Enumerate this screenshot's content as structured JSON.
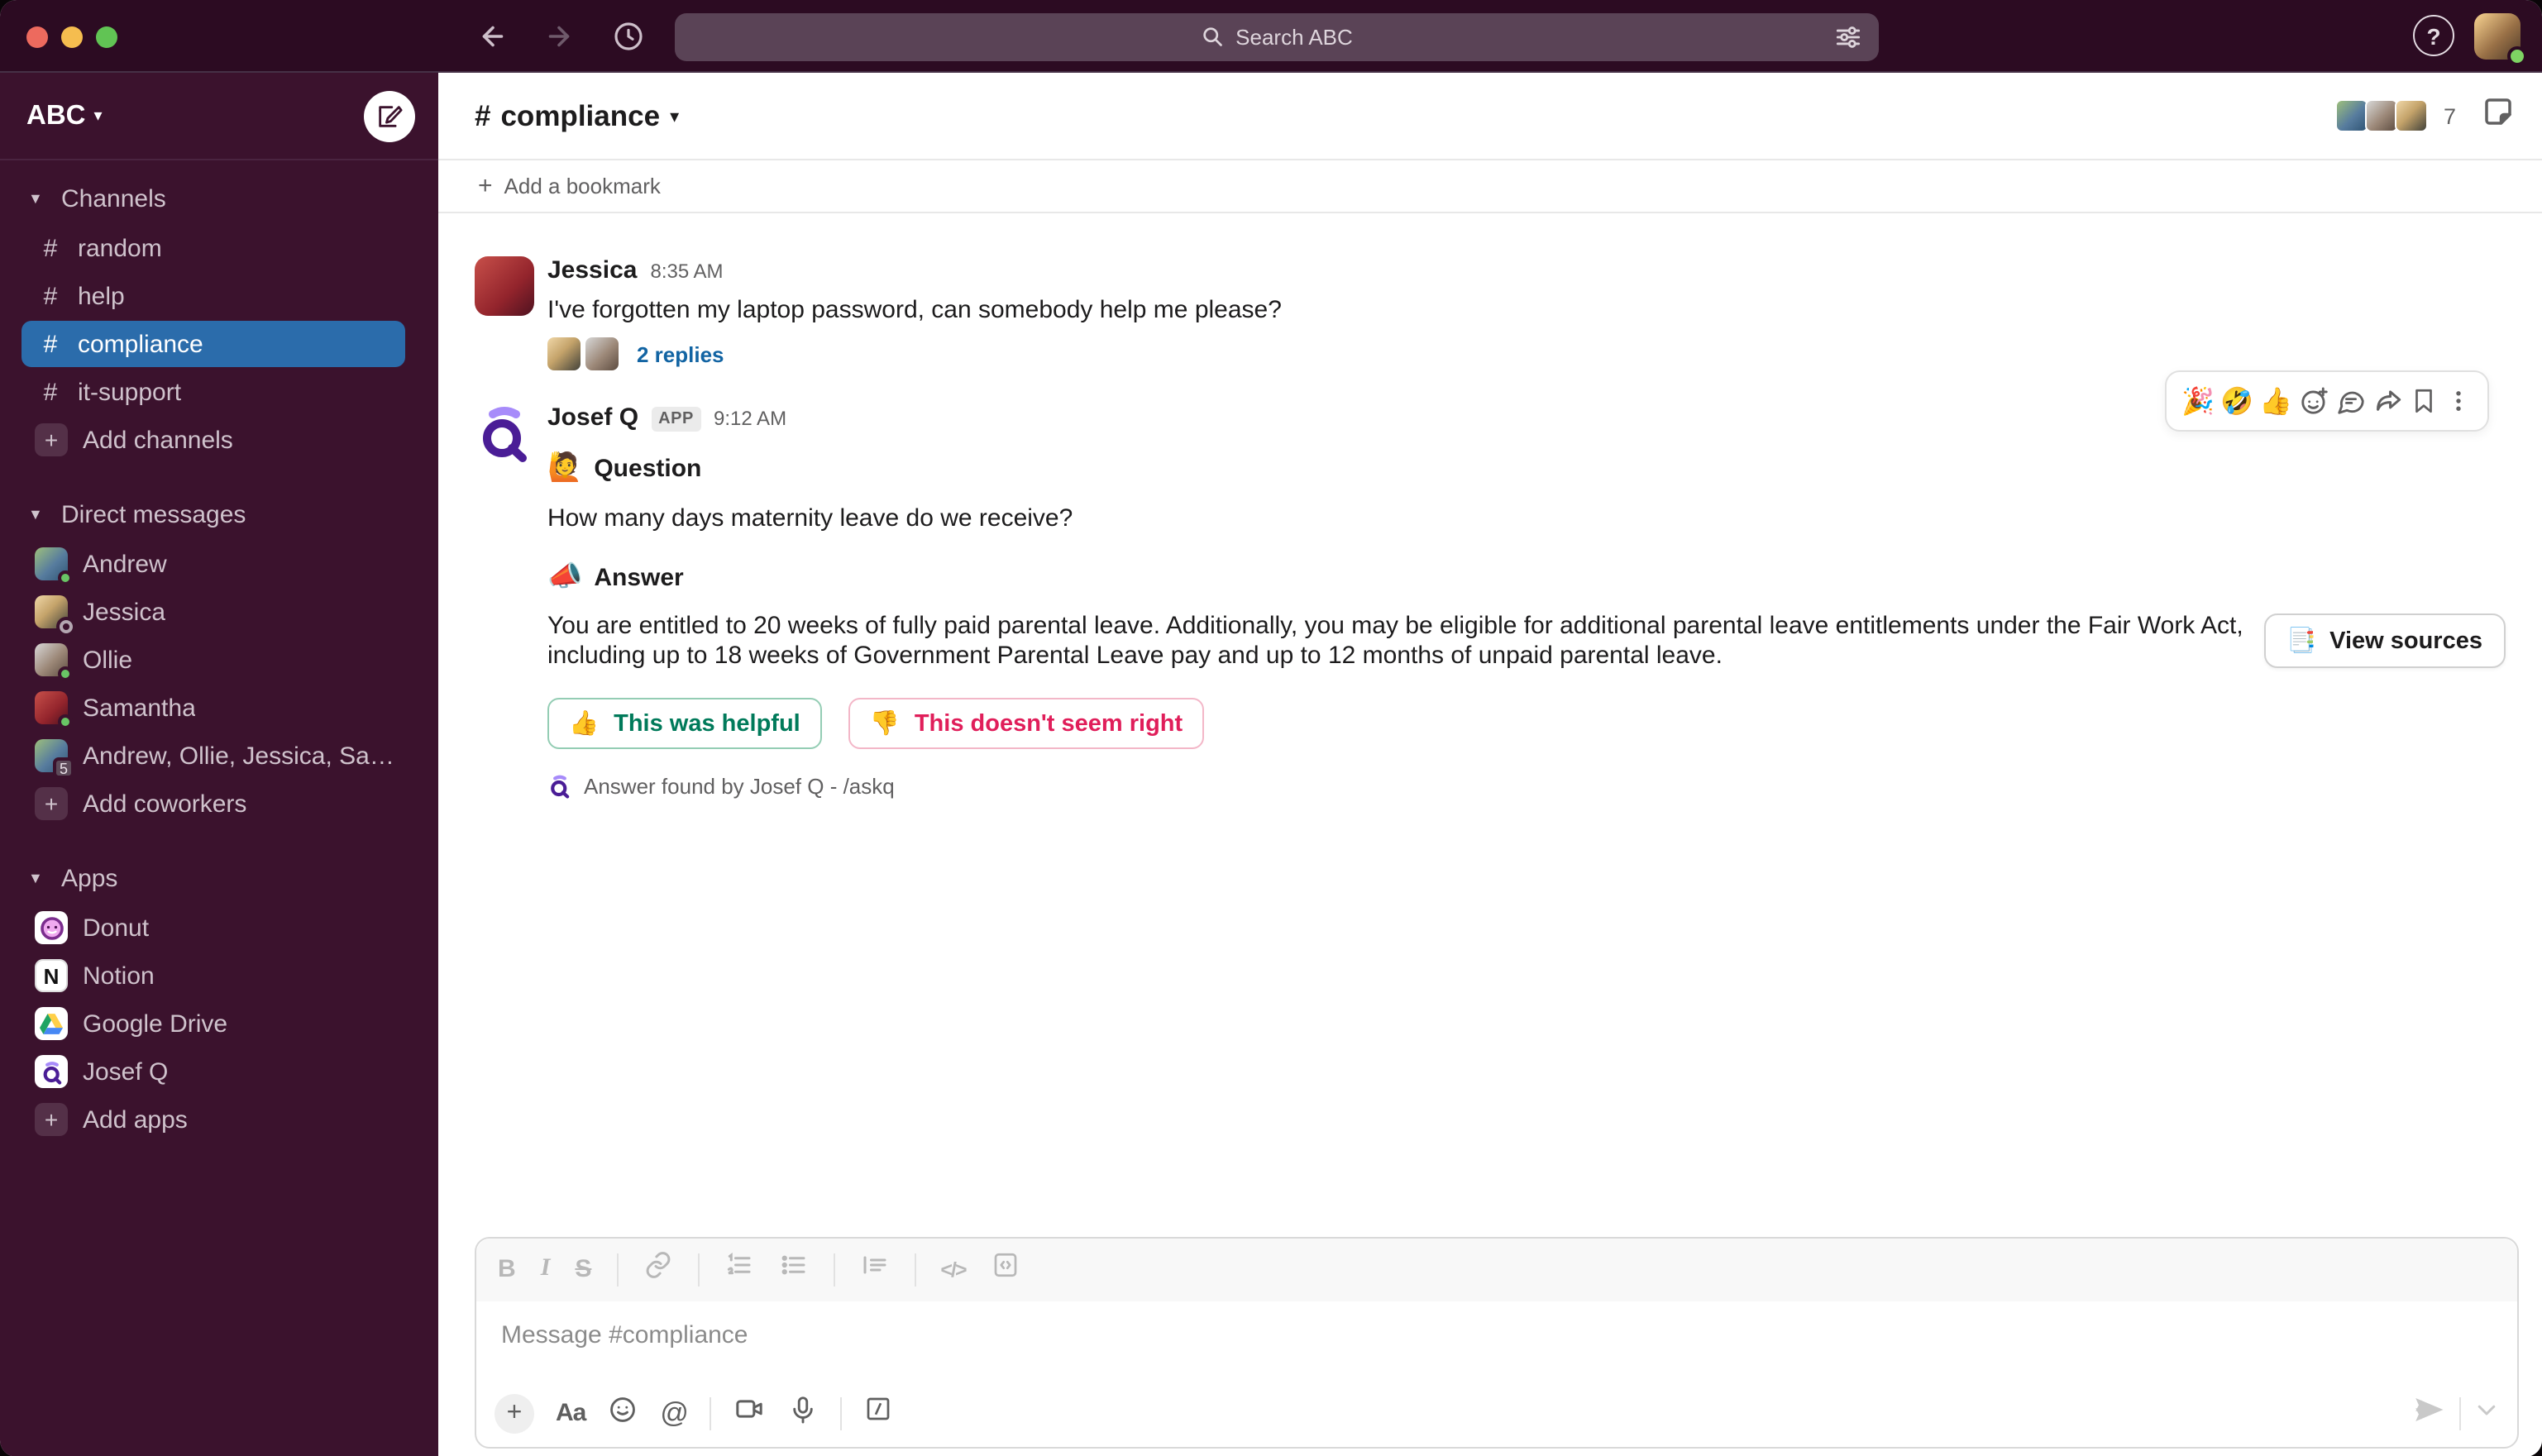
{
  "colors": {
    "topbar": "#2c0b22",
    "sidebar_bg": "#3b122d",
    "selected_channel_blue": "#2b6cab",
    "link_blue": "#1264a3",
    "helpful_green": "#007a5a",
    "wrong_pink": "#e01e5a",
    "presence_green": "#69c565"
  },
  "titlebar": {
    "search_label": "Search ABC"
  },
  "sidebar": {
    "workspace_name": "ABC",
    "hash_glyph": "#",
    "plus_glyph": "+",
    "sections": {
      "channels": {
        "header": "Channels",
        "items": [
          {
            "label": "random"
          },
          {
            "label": "help"
          },
          {
            "label": "compliance"
          },
          {
            "label": "it-support"
          }
        ],
        "add_label": "Add channels"
      },
      "dms": {
        "header": "Direct messages",
        "items": [
          {
            "label": "Andrew"
          },
          {
            "label": "Jessica"
          },
          {
            "label": "Ollie"
          },
          {
            "label": "Samantha"
          },
          {
            "label": "Andrew, Ollie, Jessica, Sam...",
            "badge": "5"
          }
        ],
        "add_label": "Add coworkers"
      },
      "apps": {
        "header": "Apps",
        "items": [
          {
            "label": "Donut"
          },
          {
            "label": "Notion"
          },
          {
            "label": "Google Drive"
          },
          {
            "label": "Josef Q"
          }
        ],
        "add_label": "Add apps"
      }
    }
  },
  "channel_header": {
    "hash": "#",
    "name": "compliance",
    "member_count": "7"
  },
  "bookmarks": {
    "plus_glyph": "+",
    "add_label": "Add a bookmark"
  },
  "messages": {
    "jessica": {
      "author": "Jessica",
      "time": "8:35 AM",
      "text": "I've forgotten my laptop password, can somebody help me please?",
      "thread_link": "2 replies"
    },
    "josefq": {
      "author": "Josef Q",
      "app_badge": "APP",
      "time": "9:12 AM",
      "question_emoji": "🙋",
      "question_heading": "Question",
      "question_text": "How many days maternity leave do we receive?",
      "answer_emoji": "📣",
      "answer_heading": "Answer",
      "answer_text": "You are entitled to 20 weeks of fully paid parental leave. Additionally, you may be eligible for additional parental leave entitlements under the Fair Work Act, including up to 18 weeks of Government Parental Leave pay and up to 12 months of unpaid parental leave.",
      "view_sources_emoji": "📑",
      "view_sources_label": "View sources",
      "helpful_emoji": "👍",
      "helpful_label": "This was helpful",
      "wrong_emoji": "👎",
      "wrong_label": "This doesn't seem right",
      "footer_text": "Answer found by Josef Q - /askq"
    }
  },
  "hover_toolbar": {
    "emojis": [
      "🎉",
      "🤣",
      "👍"
    ]
  },
  "composer": {
    "placeholder": "Message #compliance",
    "bold_glyph": "B",
    "italic_glyph": "I",
    "strike_glyph": "S",
    "code_glyph": "</>",
    "aa_label": "Aa",
    "at_glyph": "@",
    "plus_glyph": "+"
  }
}
